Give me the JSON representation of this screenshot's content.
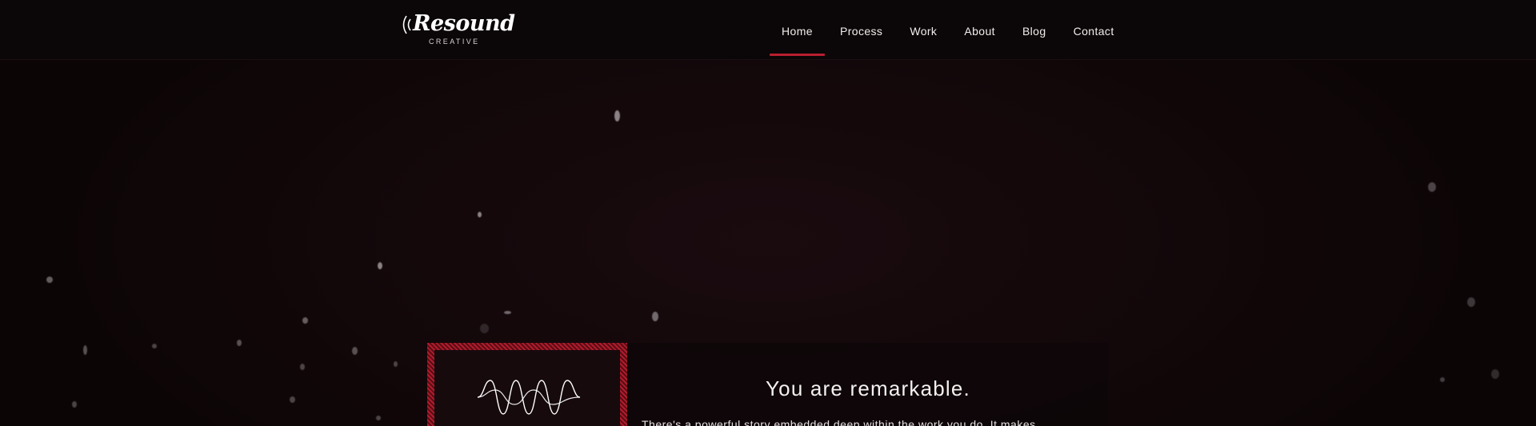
{
  "header": {
    "logo": {
      "wordmark": "Resound",
      "subtitle": "CREATIVE"
    },
    "nav": [
      {
        "label": "Home",
        "active": true
      },
      {
        "label": "Process",
        "active": false
      },
      {
        "label": "Work",
        "active": false
      },
      {
        "label": "About",
        "active": false
      },
      {
        "label": "Blog",
        "active": false
      },
      {
        "label": "Contact",
        "active": false
      }
    ]
  },
  "feature": {
    "icon": "sound-wave-icon",
    "headline": "You are remarkable.",
    "body": "There's a powerful story embedded deep within the work you do. It makes"
  },
  "colors": {
    "accent": "#b81f2f",
    "header_bg": "#0b0607",
    "hero_bg": "#110709",
    "text": "#f2eded"
  }
}
